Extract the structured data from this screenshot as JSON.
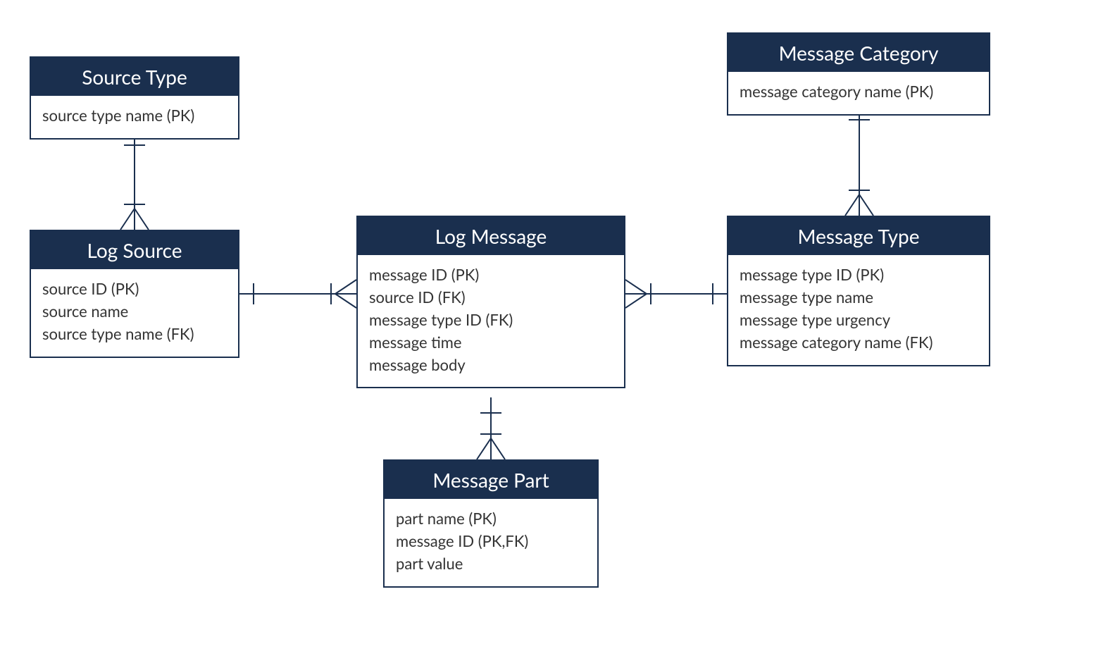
{
  "entities": {
    "sourceType": {
      "title": "Source Type",
      "attrs": [
        "source type name (PK)"
      ]
    },
    "logSource": {
      "title": "Log Source",
      "attrs": [
        "source ID (PK)",
        "source name",
        "source type name (FK)"
      ]
    },
    "logMessage": {
      "title": "Log Message",
      "attrs": [
        "message ID (PK)",
        "source ID (FK)",
        "message type ID (FK)",
        "message time",
        "message body"
      ]
    },
    "messagePart": {
      "title": "Message Part",
      "attrs": [
        "part name (PK)",
        "message ID (PK,FK)",
        "part value"
      ]
    },
    "messageType": {
      "title": "Message Type",
      "attrs": [
        "message type ID (PK)",
        "message type name",
        "message type urgency",
        "message category name (FK)"
      ]
    },
    "messageCategory": {
      "title": "Message Category",
      "attrs": [
        "message category name (PK)"
      ]
    }
  }
}
